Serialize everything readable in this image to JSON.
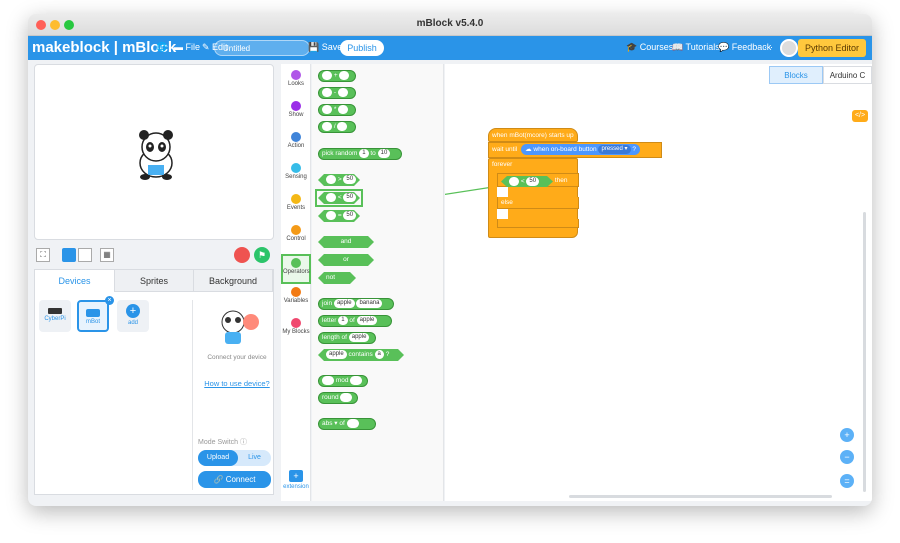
{
  "window": {
    "title": "mBlock v5.4.0",
    "traffic_lights": {
      "close": "#ff5f57",
      "minimize": "#febc2e",
      "zoom": "#28c840"
    }
  },
  "menubar": {
    "logo": "makeblock | mBlock",
    "file": "File",
    "edit": "Edit",
    "project_name": "Untitled",
    "save": "Save",
    "publish": "Publish",
    "courses": "Courses",
    "tutorials": "Tutorials",
    "feedback": "Feedback",
    "more": "···",
    "python_editor": "Python Editor",
    "bg": "#2a94e8"
  },
  "left_panel": {
    "tabs": [
      "Devices",
      "Sprites",
      "Background"
    ],
    "devices": [
      {
        "label": "CyberPi"
      },
      {
        "label": "mBot"
      },
      {
        "label": "add"
      }
    ],
    "connect_hint": "Connect your device",
    "how_to_use": "How to use device?",
    "mode_switch": "Mode Switch ⓘ",
    "upload": "Upload",
    "live": "Live",
    "connect": "Connect"
  },
  "categories": [
    {
      "label": "Looks",
      "color": "#b057e8"
    },
    {
      "label": "Show",
      "color": "#9b2ee8"
    },
    {
      "label": "Action",
      "color": "#3f84d9"
    },
    {
      "label": "Sensing",
      "color": "#36bce8"
    },
    {
      "label": "Events",
      "color": "#f4b816"
    },
    {
      "label": "Control",
      "color": "#f49a17"
    },
    {
      "label": "Operators",
      "color": "#59c059"
    },
    {
      "label": "Variables",
      "color": "#f27a13"
    },
    {
      "label": "My Blocks",
      "color": "#f0486e"
    }
  ],
  "extension": "extension",
  "palette": {
    "arith": [
      "+",
      "-",
      "*",
      "/"
    ],
    "pick_random": {
      "text": "pick random",
      "a": "1",
      "to": "to",
      "b": "10"
    },
    "compare": [
      {
        "op": ">",
        "val": "50"
      },
      {
        "op": "<",
        "val": "50"
      },
      {
        "op": "=",
        "val": "50"
      }
    ],
    "and": "and",
    "or": "or",
    "not": "not",
    "join": {
      "text": "join",
      "a": "apple",
      "b": "banana"
    },
    "letter": {
      "text": "letter",
      "n": "1",
      "of": "of",
      "w": "apple"
    },
    "length": {
      "text": "length of",
      "w": "apple"
    },
    "contains": {
      "w": "apple",
      "text": "contains",
      "c": "a",
      "q": "?"
    },
    "mod": "mod",
    "round": "round",
    "abs": {
      "text": "abs ▾",
      "of": "of"
    }
  },
  "workspace": {
    "tabs": [
      "Blocks",
      "Arduino C"
    ],
    "script": {
      "hat": "when mBot(mcore) starts up",
      "wait": "wait until",
      "sensor": "when on-board button",
      "state": "pressed ▾",
      "q": "?",
      "forever": "forever",
      "if_op": "<",
      "if_val": "50",
      "then": "then",
      "else": "else"
    },
    "zoom": [
      "+",
      "−",
      "="
    ]
  }
}
